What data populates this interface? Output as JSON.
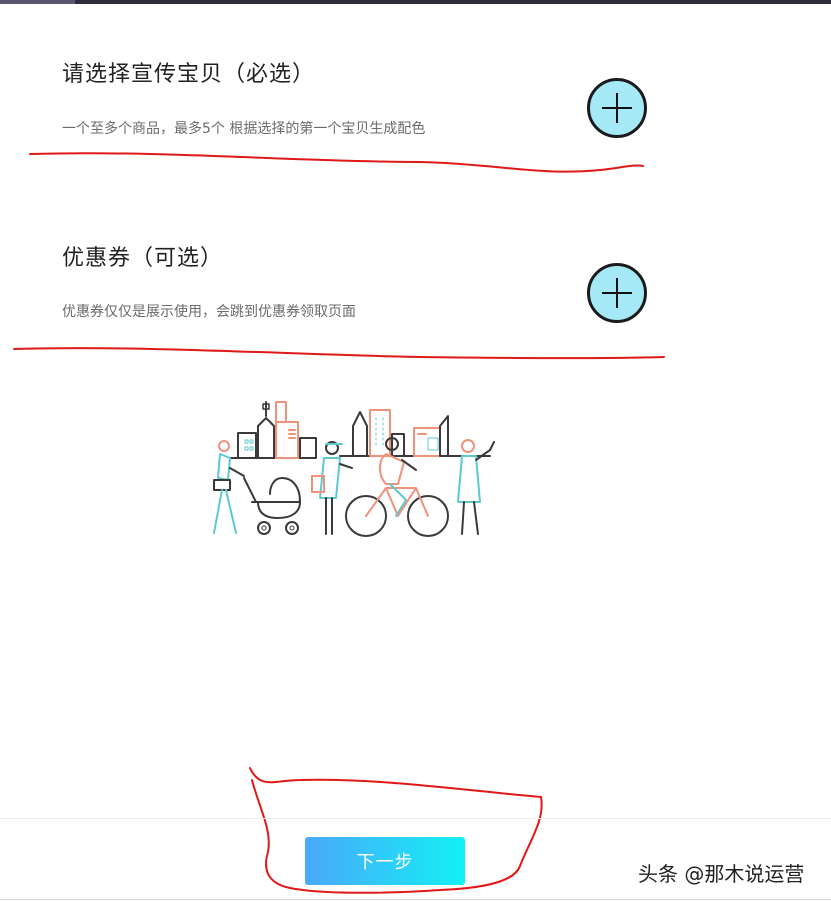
{
  "section_product": {
    "title": "请选择宣传宝贝（必选）",
    "description": "一个至多个商品，最多5个 根据选择的第一个宝贝生成配色"
  },
  "section_coupon": {
    "title": "优惠券（可选）",
    "description": "优惠券仅仅是展示使用，会跳到优惠券领取页面"
  },
  "footer": {
    "next_label": "下一步"
  },
  "watermark": "头条 @那木说运营",
  "icons": {
    "add": "plus-circle-icon",
    "illustration": "city-people-illustration"
  },
  "colors": {
    "add_fill": "#a5e9f7",
    "button_gradient_start": "#4aa8fb",
    "button_gradient_end": "#13f0f5",
    "annotation_red": "#e01818",
    "illustration_salmon": "#f0917a",
    "illustration_teal": "#5cc9cf"
  }
}
